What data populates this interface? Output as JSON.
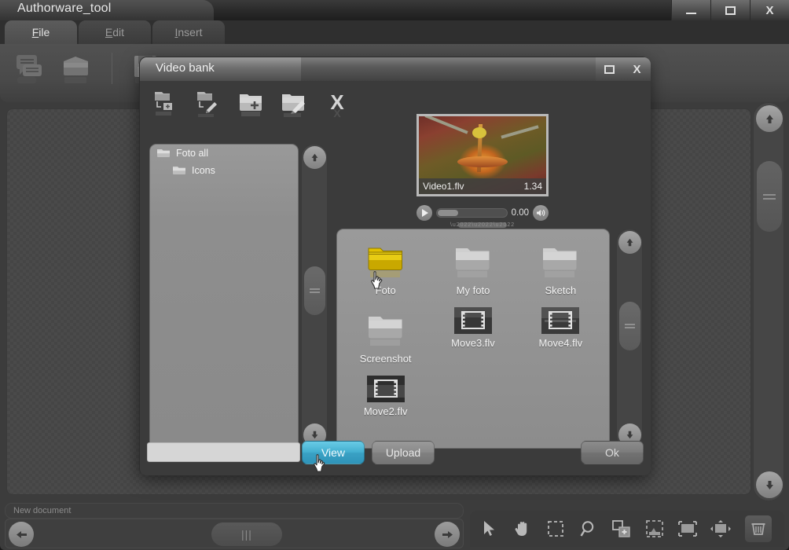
{
  "app": {
    "title": "Authorware_tool",
    "window_controls": [
      {
        "name": "minimize",
        "glyph": "minimize-icon"
      },
      {
        "name": "maximize",
        "glyph": "maximize-icon"
      },
      {
        "name": "close",
        "glyph": "close-icon",
        "label": "X"
      }
    ]
  },
  "tabs": [
    {
      "id": "file",
      "label": "File",
      "accel": "F",
      "rest": "ile",
      "active": true
    },
    {
      "id": "edit",
      "label": "Edit",
      "accel": "E",
      "rest": "dit",
      "active": false
    },
    {
      "id": "insert",
      "label": "Insert",
      "accel": "I",
      "rest": "nsert",
      "active": false
    }
  ],
  "toolbar": {
    "icons": [
      {
        "name": "comment-icon"
      },
      {
        "name": "open-folder-icon"
      },
      {
        "name": "save-floppy-icon"
      }
    ]
  },
  "statusbar": {
    "document_label": "New document"
  },
  "bottom_slider": {
    "left_arrow": "◀",
    "right_arrow": "▶",
    "handle_grip": "|||"
  },
  "tool_panel": {
    "tools": [
      {
        "name": "select-arrow-icon"
      },
      {
        "name": "hand-pan-icon"
      },
      {
        "name": "marquee-select-icon"
      },
      {
        "name": "zoom-magnifier-icon"
      },
      {
        "name": "add-object-icon"
      },
      {
        "name": "crop-icon"
      },
      {
        "name": "fit-width-icon"
      },
      {
        "name": "fit-height-icon"
      },
      {
        "name": "trash-icon"
      }
    ]
  },
  "dialog": {
    "title": "Video bank",
    "window_controls": [
      {
        "name": "maximize",
        "glyph": "maximize-icon"
      },
      {
        "name": "close",
        "glyph": "close-icon",
        "label": "X"
      }
    ],
    "toolbar_icons": [
      {
        "name": "folder-add-sub-icon"
      },
      {
        "name": "folder-edit-sub-icon"
      },
      {
        "name": "folder-new-icon"
      },
      {
        "name": "folder-rename-icon"
      },
      {
        "name": "delete-x-icon",
        "label": "X"
      }
    ],
    "tree": {
      "items": [
        {
          "label": "Foto all",
          "level": 0,
          "icon": "folder-icon"
        },
        {
          "label": "Icons",
          "level": 1,
          "icon": "folder-icon"
        }
      ]
    },
    "preview": {
      "filename": "Video1.flv",
      "duration": "1.34",
      "current_time": "0.00",
      "play_glyph": "▶",
      "volume_glyph": "◂))"
    },
    "files": [
      {
        "label": "Foto",
        "type": "folder",
        "selected": true
      },
      {
        "label": "My foto",
        "type": "folder",
        "selected": false
      },
      {
        "label": "Sketch",
        "type": "folder",
        "selected": false
      },
      {
        "label": "Screenshot",
        "type": "folder",
        "selected": false
      },
      {
        "label": "Move3.flv",
        "type": "video",
        "selected": false
      },
      {
        "label": "Move4.flv",
        "type": "video",
        "selected": false
      },
      {
        "label": "Move2.flv",
        "type": "video",
        "selected": false
      }
    ],
    "footer": {
      "path_value": "",
      "path_placeholder": "",
      "view_label": "View",
      "upload_label": "Upload",
      "ok_label": "Ok"
    },
    "scrollbars": {
      "up_glyph": "⬆",
      "down_glyph": "⬇"
    }
  },
  "colors": {
    "accent_cyan": "#43afd0",
    "folder_selected": "#d4b400",
    "window_bg": "#3c3c3c",
    "panel_bg": "#8e8e8e"
  }
}
